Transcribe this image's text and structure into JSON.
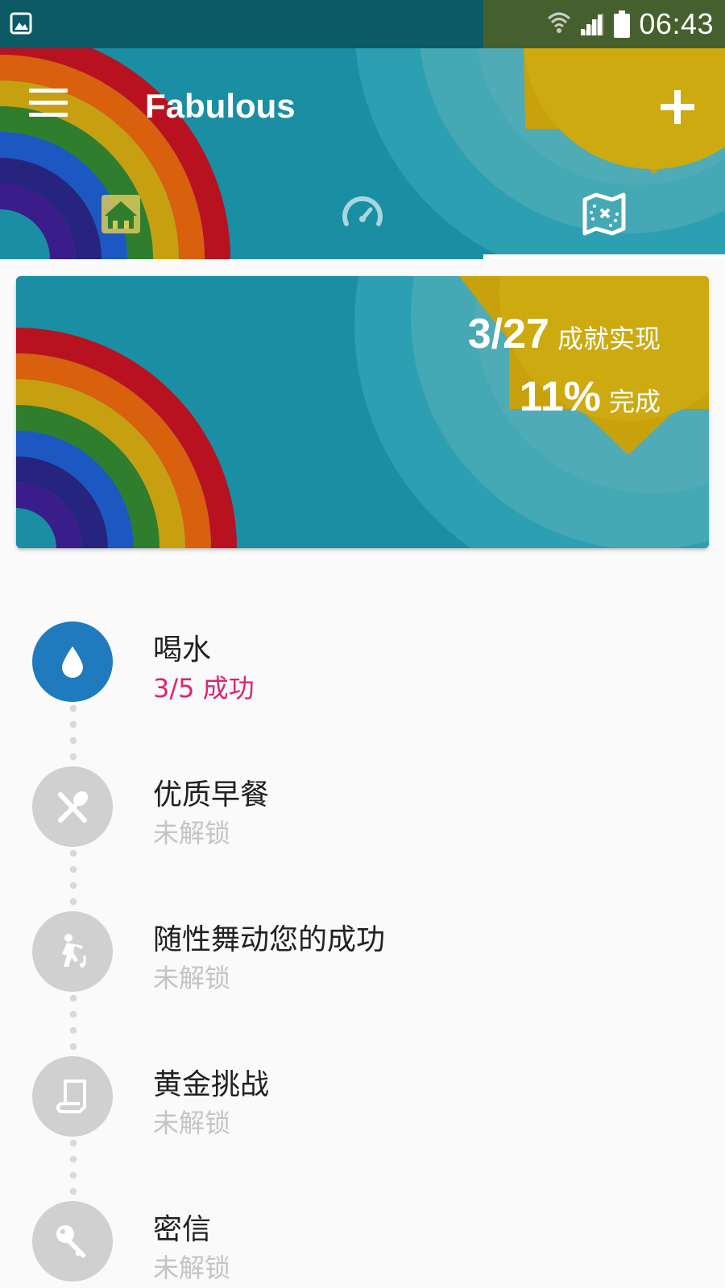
{
  "status_bar": {
    "time": "06:43",
    "icons": [
      "gallery-icon",
      "wifi-icon",
      "signal-icon",
      "battery-icon"
    ]
  },
  "app_bar": {
    "title": "Fabulous",
    "menu_icon": "menu-icon",
    "add_icon": "plus-icon"
  },
  "tabs": [
    {
      "icon": "house-icon",
      "selected": false
    },
    {
      "icon": "speedometer-icon",
      "selected": false
    },
    {
      "icon": "treasure-map-icon",
      "selected": true
    }
  ],
  "summary": {
    "achievements_value": "3/27",
    "achievements_label": "成就实现",
    "percent_value": "11%",
    "percent_label": "完成"
  },
  "achievements": [
    {
      "title": "喝水",
      "status": "3/5 成功",
      "icon": "water-drop-icon",
      "unlocked": true
    },
    {
      "title": "优质早餐",
      "status": "未解锁",
      "icon": "fork-spoon-icon",
      "unlocked": false
    },
    {
      "title": "随性舞动您的成功",
      "status": "未解锁",
      "icon": "dancing-icon",
      "unlocked": false
    },
    {
      "title": "黄金挑战",
      "status": "未解锁",
      "icon": "scroll-icon",
      "unlocked": false
    },
    {
      "title": "密信",
      "status": "未解锁",
      "icon": "key-icon",
      "unlocked": false
    }
  ],
  "colors": {
    "teal": "#1a8ea3",
    "sun_yellow": "#ccaa10",
    "active_blue": "#1f7bbd",
    "success_pink": "#e0246e",
    "locked_gray": "#d0d0d0"
  }
}
